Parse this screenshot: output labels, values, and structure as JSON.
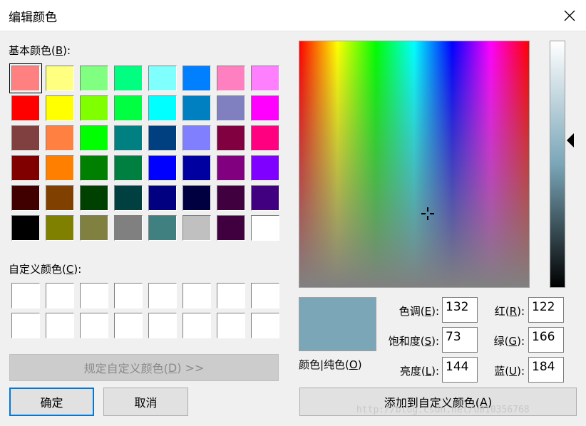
{
  "title": "编辑颜色",
  "basic_colors_label": {
    "pre": "基本颜色(",
    "key": "B",
    "post": "):"
  },
  "custom_colors_label": {
    "pre": "自定义颜色(",
    "key": "C",
    "post": "):"
  },
  "basic_colors": [
    [
      "#ff8080",
      "#ffff80",
      "#80ff80",
      "#00ff80",
      "#80ffff",
      "#0080ff",
      "#ff80c0",
      "#ff80ff"
    ],
    [
      "#ff0000",
      "#ffff00",
      "#80ff00",
      "#00ff40",
      "#00ffff",
      "#0080c0",
      "#8080c0",
      "#ff00ff"
    ],
    [
      "#804040",
      "#ff8040",
      "#00ff00",
      "#008080",
      "#004080",
      "#8080ff",
      "#800040",
      "#ff0080"
    ],
    [
      "#800000",
      "#ff8000",
      "#008000",
      "#008040",
      "#0000ff",
      "#0000a0",
      "#800080",
      "#8000ff"
    ],
    [
      "#400000",
      "#804000",
      "#004000",
      "#004040",
      "#000080",
      "#000040",
      "#400040",
      "#400080"
    ],
    [
      "#000000",
      "#808000",
      "#808040",
      "#808080",
      "#408080",
      "#c0c0c0",
      "#400040",
      "#ffffff"
    ]
  ],
  "define_custom_button": {
    "pre": "规定自定义颜色(",
    "key": "D",
    "post": ") >>"
  },
  "ok_button": "确定",
  "cancel_button": "取消",
  "preview_label": {
    "pre": "颜色|纯色(",
    "key": "O",
    "post": ")"
  },
  "preview_color": "#7aa6b8",
  "hue": {
    "pre": "色调(",
    "key": "E",
    "post": "):",
    "value": "132"
  },
  "sat": {
    "pre": "饱和度(",
    "key": "S",
    "post": "):",
    "value": "73"
  },
  "lum": {
    "pre": "亮度(",
    "key": "L",
    "post": "):",
    "value": "144"
  },
  "red": {
    "pre": "红(",
    "key": "R",
    "post": "):",
    "value": "122"
  },
  "green": {
    "pre": "绿(",
    "key": "G",
    "post": "):",
    "value": "166"
  },
  "blue": {
    "pre": "蓝(",
    "key": "U",
    "post": "):",
    "value": "184"
  },
  "add_custom_button": {
    "pre": "添加到自定义颜色(",
    "key": "A",
    "post": ")"
  },
  "watermark": "http://blog.csdn.net/u010356768"
}
